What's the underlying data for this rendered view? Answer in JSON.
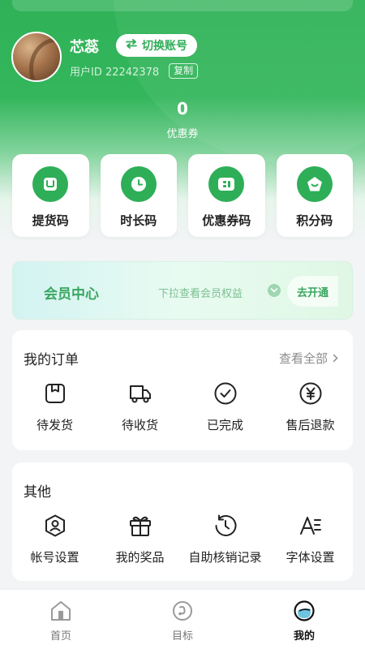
{
  "profile": {
    "username": "芯蕊",
    "switch_account_label": "切换账号",
    "user_id_label": "用户ID 22242378",
    "copy_label": "复制"
  },
  "coupon": {
    "count": "0",
    "label": "优惠券"
  },
  "codes": [
    {
      "label": "提货码",
      "icon": "pickup-code-icon"
    },
    {
      "label": "时长码",
      "icon": "clock-icon"
    },
    {
      "label": "优惠券码",
      "icon": "coupon-ticket-icon"
    },
    {
      "label": "积分码",
      "icon": "points-icon"
    }
  ],
  "member": {
    "title": "会员中心",
    "hint": "下拉查看会员权益",
    "open_label": "去开通"
  },
  "orders": {
    "title": "我的订单",
    "view_all": "查看全部",
    "items": [
      {
        "label": "待发货",
        "icon": "package-icon"
      },
      {
        "label": "待收货",
        "icon": "truck-icon"
      },
      {
        "label": "已完成",
        "icon": "check-circle-icon"
      },
      {
        "label": "售后退款",
        "icon": "yen-refund-icon"
      }
    ]
  },
  "other": {
    "title": "其他",
    "items": [
      {
        "label": "帐号设置",
        "icon": "account-settings-icon"
      },
      {
        "label": "我的奖品",
        "icon": "gift-icon"
      },
      {
        "label": "自助核销记录",
        "icon": "history-icon"
      },
      {
        "label": "字体设置",
        "icon": "font-size-icon"
      }
    ]
  },
  "tabbar": {
    "items": [
      {
        "label": "首页",
        "icon": "home-icon",
        "active": false
      },
      {
        "label": "目标",
        "icon": "target-icon",
        "active": false
      },
      {
        "label": "我的",
        "icon": "profile-icon",
        "active": true
      }
    ]
  },
  "colors": {
    "brand_green": "#2fae58",
    "text_dark": "#222222",
    "text_muted": "#8b8b8b"
  }
}
